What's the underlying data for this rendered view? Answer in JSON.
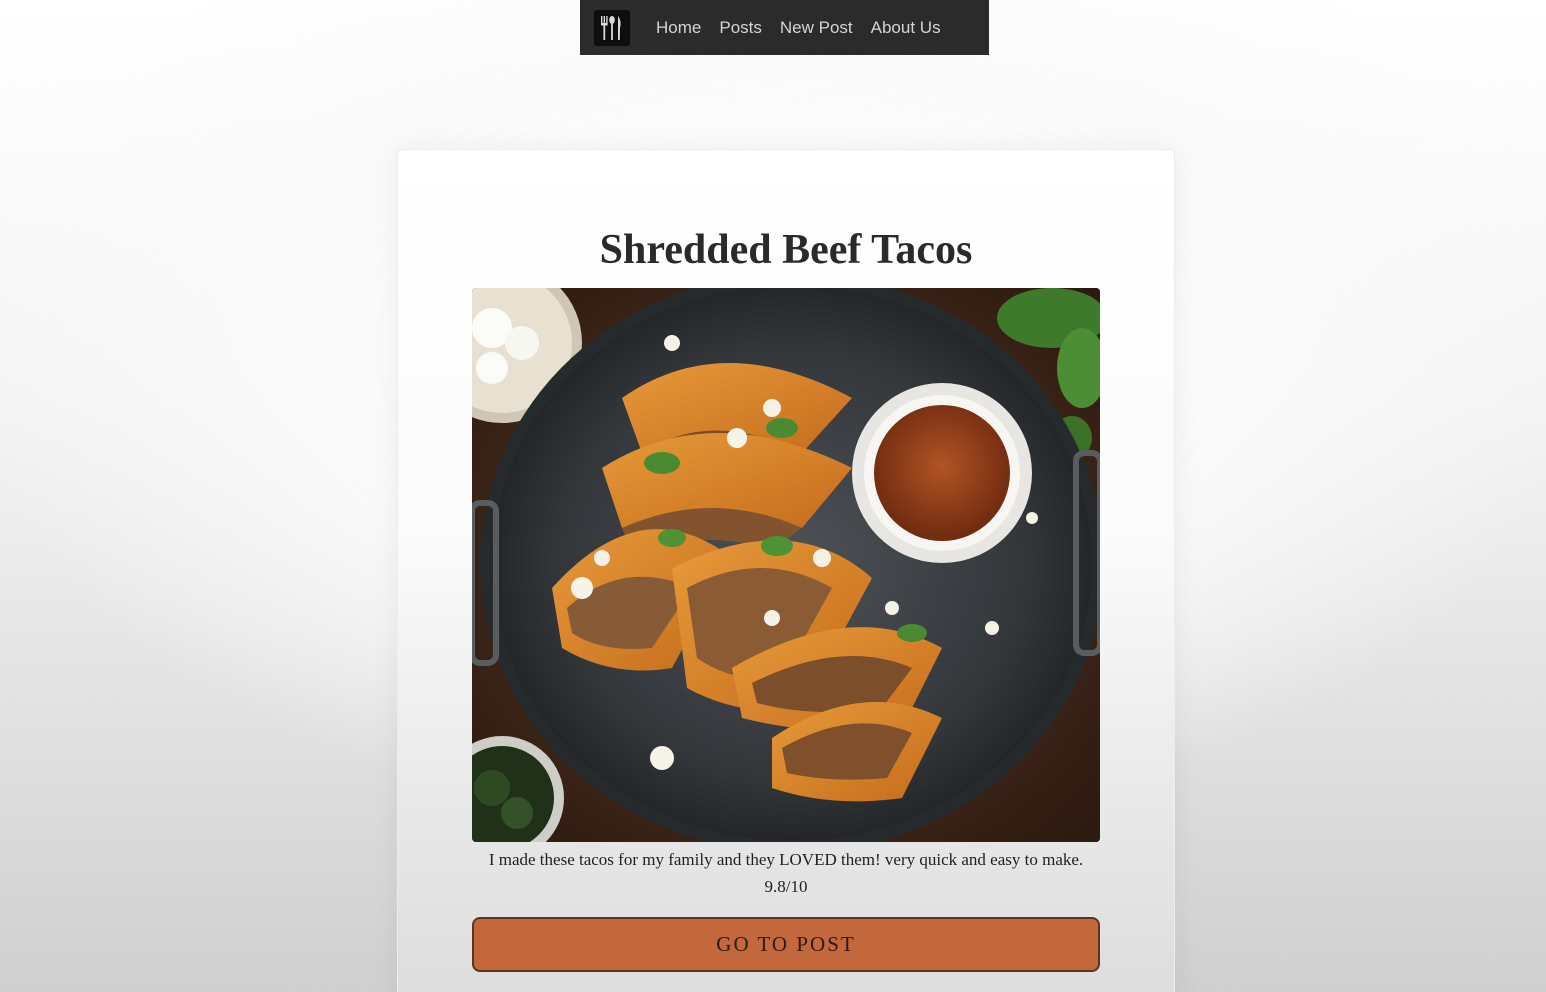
{
  "nav": {
    "logo_icon": "utensils-icon",
    "links": [
      "Home",
      "Posts",
      "New Post",
      "About Us"
    ]
  },
  "post": {
    "title": "Shredded Beef Tacos",
    "image_subject": "food-photo-tacos",
    "description": "I made these tacos for my family and they LOVED them! very quick and easy to make. 9.8/10",
    "button_label": "GO TO POST"
  },
  "colors": {
    "navbar_bg": "#2b2b2b",
    "button_bg": "#c2683c",
    "button_border": "#5c3422",
    "title_text": "#2a2a2a"
  }
}
